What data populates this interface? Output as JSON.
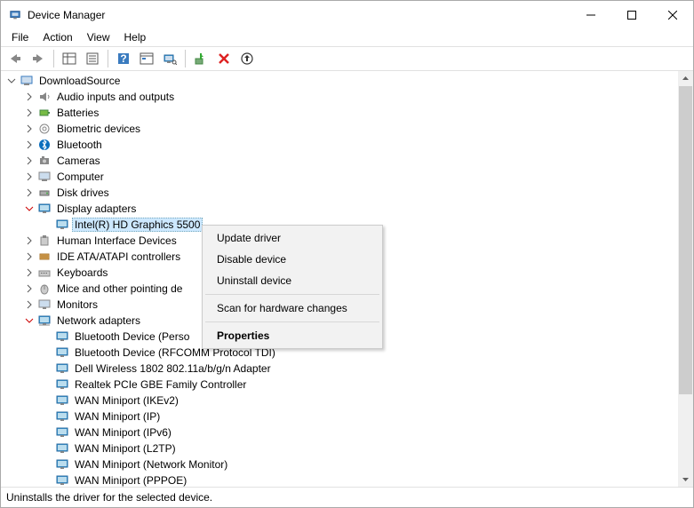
{
  "window": {
    "title": "Device Manager"
  },
  "menu": {
    "file": "File",
    "action": "Action",
    "view": "View",
    "help": "Help"
  },
  "tree": {
    "root": "DownloadSource",
    "cat_audio": "Audio inputs and outputs",
    "cat_batteries": "Batteries",
    "cat_biometric": "Biometric devices",
    "cat_bluetooth": "Bluetooth",
    "cat_cameras": "Cameras",
    "cat_computer": "Computer",
    "cat_disk": "Disk drives",
    "cat_display": "Display adapters",
    "dev_intelhd": "Intel(R) HD Graphics 5500",
    "cat_hid": "Human Interface Devices",
    "cat_ide": "IDE ATA/ATAPI controllers",
    "cat_keyboards": "Keyboards",
    "cat_mice": "Mice and other pointing de",
    "cat_monitors": "Monitors",
    "cat_network": "Network adapters",
    "net0": "Bluetooth Device (Perso",
    "net1": "Bluetooth Device (RFCOMM Protocol TDI)",
    "net2": "Dell Wireless 1802 802.11a/b/g/n Adapter",
    "net3": "Realtek PCIe GBE Family Controller",
    "net4": "WAN Miniport (IKEv2)",
    "net5": "WAN Miniport (IP)",
    "net6": "WAN Miniport (IPv6)",
    "net7": "WAN Miniport (L2TP)",
    "net8": "WAN Miniport (Network Monitor)",
    "net9": "WAN Miniport (PPPOE)"
  },
  "context_menu": {
    "update": "Update driver",
    "disable": "Disable device",
    "uninstall": "Uninstall device",
    "scan": "Scan for hardware changes",
    "properties": "Properties"
  },
  "status": "Uninstalls the driver for the selected device."
}
